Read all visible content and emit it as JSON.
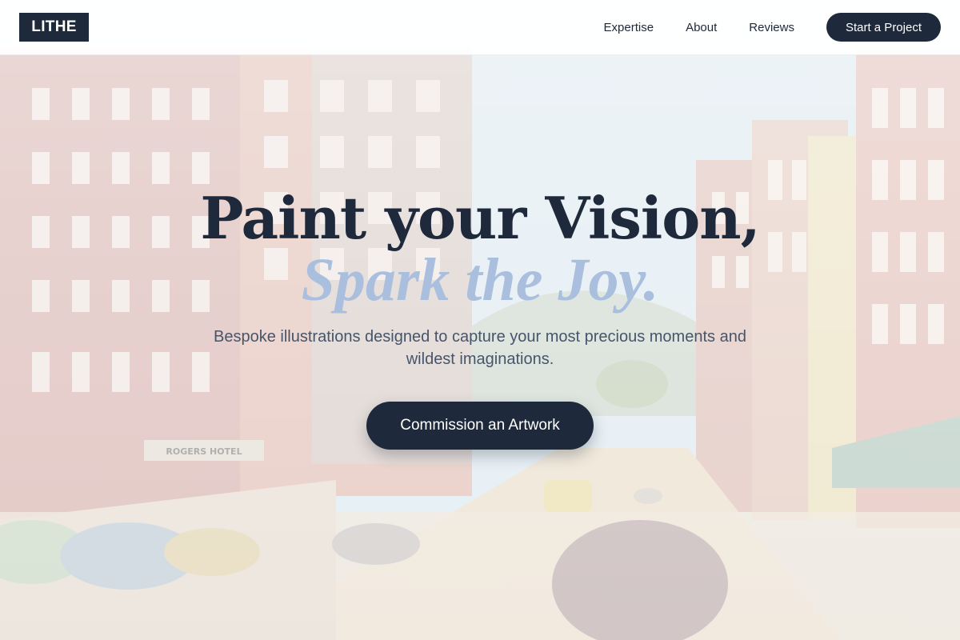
{
  "header": {
    "logo": "LITHE",
    "nav": [
      "Expertise",
      "About",
      "Reviews"
    ],
    "cta": "Start a Project"
  },
  "hero": {
    "headline": "Paint your Vision,",
    "headline_accent": "Spark the Joy.",
    "subtitle": "Bespoke illustrations designed to capture your most precious moments and wildest imaginations.",
    "cta": "Commission an Artwork"
  },
  "colors": {
    "primary": "#1e293b",
    "accent": "#a9bfdd",
    "muted_text": "#475569"
  }
}
